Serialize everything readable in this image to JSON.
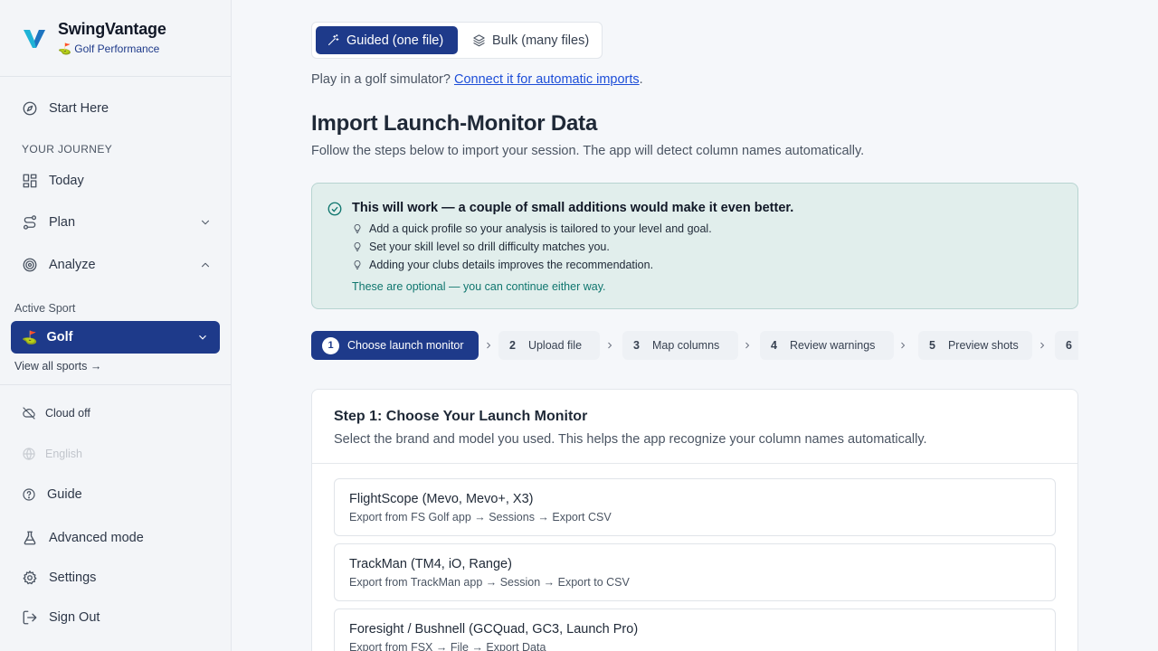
{
  "brand": {
    "name": "SwingVantage",
    "emoji": "⛳",
    "subtitle": "Golf Performance"
  },
  "sidebar": {
    "start_here": "Start Here",
    "section_label": "YOUR JOURNEY",
    "items": [
      {
        "label": "Today",
        "icon": "grid-icon"
      },
      {
        "label": "Plan",
        "icon": "route-icon"
      },
      {
        "label": "Analyze",
        "icon": "target-icon"
      }
    ],
    "active_sport_label": "Active Sport",
    "active_sport": {
      "emoji": "⛳",
      "label": "Golf"
    },
    "view_all_sports": "View all sports →",
    "cloud_status": "Cloud off",
    "language": "English",
    "bottom_items": [
      {
        "label": "Guide"
      },
      {
        "label": "Advanced mode"
      },
      {
        "label": "Settings"
      },
      {
        "label": "Sign Out"
      }
    ]
  },
  "mode": {
    "guided": "Guided (one file)",
    "bulk": "Bulk (many files)"
  },
  "simulator": {
    "prefix": "Play in a golf simulator? ",
    "link": "Connect it for automatic imports",
    "suffix": "."
  },
  "page": {
    "title": "Import Launch-Monitor Data",
    "description": "Follow the steps below to import your session. The app will detect column names automatically."
  },
  "notice": {
    "title": "This will work — a couple of small additions would make it even better.",
    "tips": [
      "Add a quick profile so your analysis is tailored to your level and goal.",
      "Set your skill level so drill difficulty matches you.",
      "Adding your clubs details improves the recommendation."
    ],
    "footer": "These are optional — you can continue either way."
  },
  "steps": [
    {
      "num": "1",
      "label": "Choose launch monitor"
    },
    {
      "num": "2",
      "label": "Upload file"
    },
    {
      "num": "3",
      "label": "Map columns"
    },
    {
      "num": "4",
      "label": "Review warnings"
    },
    {
      "num": "5",
      "label": "Preview shots"
    },
    {
      "num": "6",
      "label": ""
    }
  ],
  "step1": {
    "title": "Step 1: Choose Your Launch Monitor",
    "description": "Select the brand and model you used. This helps the app recognize your column names automatically.",
    "options": [
      {
        "name": "FlightScope (Mevo, Mevo+, X3)",
        "path": "Export from FS Golf app → Sessions → Export CSV"
      },
      {
        "name": "TrackMan (TM4, iO, Range)",
        "path": "Export from TrackMan app → Session → Export to CSV"
      },
      {
        "name": "Foresight / Bushnell (GCQuad, GC3, Launch Pro)",
        "path": "Export from FSX → File → Export Data"
      }
    ]
  },
  "colors": {
    "primary": "#1e3a8a",
    "notice_bg": "#e1eeec",
    "notice_accent": "#0f766e",
    "link": "#1d4ed8"
  }
}
